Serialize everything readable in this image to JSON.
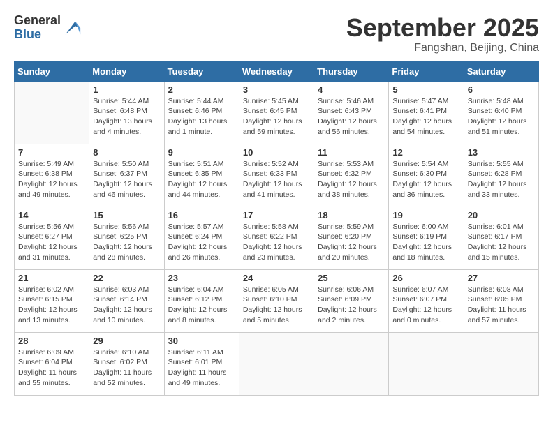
{
  "logo": {
    "general": "General",
    "blue": "Blue"
  },
  "header": {
    "month": "September 2025",
    "location": "Fangshan, Beijing, China"
  },
  "weekdays": [
    "Sunday",
    "Monday",
    "Tuesday",
    "Wednesday",
    "Thursday",
    "Friday",
    "Saturday"
  ],
  "weeks": [
    [
      {
        "day": "",
        "sunrise": "",
        "sunset": "",
        "daylight": ""
      },
      {
        "day": "1",
        "sunrise": "Sunrise: 5:44 AM",
        "sunset": "Sunset: 6:48 PM",
        "daylight": "Daylight: 13 hours and 4 minutes."
      },
      {
        "day": "2",
        "sunrise": "Sunrise: 5:44 AM",
        "sunset": "Sunset: 6:46 PM",
        "daylight": "Daylight: 13 hours and 1 minute."
      },
      {
        "day": "3",
        "sunrise": "Sunrise: 5:45 AM",
        "sunset": "Sunset: 6:45 PM",
        "daylight": "Daylight: 12 hours and 59 minutes."
      },
      {
        "day": "4",
        "sunrise": "Sunrise: 5:46 AM",
        "sunset": "Sunset: 6:43 PM",
        "daylight": "Daylight: 12 hours and 56 minutes."
      },
      {
        "day": "5",
        "sunrise": "Sunrise: 5:47 AM",
        "sunset": "Sunset: 6:41 PM",
        "daylight": "Daylight: 12 hours and 54 minutes."
      },
      {
        "day": "6",
        "sunrise": "Sunrise: 5:48 AM",
        "sunset": "Sunset: 6:40 PM",
        "daylight": "Daylight: 12 hours and 51 minutes."
      }
    ],
    [
      {
        "day": "7",
        "sunrise": "Sunrise: 5:49 AM",
        "sunset": "Sunset: 6:38 PM",
        "daylight": "Daylight: 12 hours and 49 minutes."
      },
      {
        "day": "8",
        "sunrise": "Sunrise: 5:50 AM",
        "sunset": "Sunset: 6:37 PM",
        "daylight": "Daylight: 12 hours and 46 minutes."
      },
      {
        "day": "9",
        "sunrise": "Sunrise: 5:51 AM",
        "sunset": "Sunset: 6:35 PM",
        "daylight": "Daylight: 12 hours and 44 minutes."
      },
      {
        "day": "10",
        "sunrise": "Sunrise: 5:52 AM",
        "sunset": "Sunset: 6:33 PM",
        "daylight": "Daylight: 12 hours and 41 minutes."
      },
      {
        "day": "11",
        "sunrise": "Sunrise: 5:53 AM",
        "sunset": "Sunset: 6:32 PM",
        "daylight": "Daylight: 12 hours and 38 minutes."
      },
      {
        "day": "12",
        "sunrise": "Sunrise: 5:54 AM",
        "sunset": "Sunset: 6:30 PM",
        "daylight": "Daylight: 12 hours and 36 minutes."
      },
      {
        "day": "13",
        "sunrise": "Sunrise: 5:55 AM",
        "sunset": "Sunset: 6:28 PM",
        "daylight": "Daylight: 12 hours and 33 minutes."
      }
    ],
    [
      {
        "day": "14",
        "sunrise": "Sunrise: 5:56 AM",
        "sunset": "Sunset: 6:27 PM",
        "daylight": "Daylight: 12 hours and 31 minutes."
      },
      {
        "day": "15",
        "sunrise": "Sunrise: 5:56 AM",
        "sunset": "Sunset: 6:25 PM",
        "daylight": "Daylight: 12 hours and 28 minutes."
      },
      {
        "day": "16",
        "sunrise": "Sunrise: 5:57 AM",
        "sunset": "Sunset: 6:24 PM",
        "daylight": "Daylight: 12 hours and 26 minutes."
      },
      {
        "day": "17",
        "sunrise": "Sunrise: 5:58 AM",
        "sunset": "Sunset: 6:22 PM",
        "daylight": "Daylight: 12 hours and 23 minutes."
      },
      {
        "day": "18",
        "sunrise": "Sunrise: 5:59 AM",
        "sunset": "Sunset: 6:20 PM",
        "daylight": "Daylight: 12 hours and 20 minutes."
      },
      {
        "day": "19",
        "sunrise": "Sunrise: 6:00 AM",
        "sunset": "Sunset: 6:19 PM",
        "daylight": "Daylight: 12 hours and 18 minutes."
      },
      {
        "day": "20",
        "sunrise": "Sunrise: 6:01 AM",
        "sunset": "Sunset: 6:17 PM",
        "daylight": "Daylight: 12 hours and 15 minutes."
      }
    ],
    [
      {
        "day": "21",
        "sunrise": "Sunrise: 6:02 AM",
        "sunset": "Sunset: 6:15 PM",
        "daylight": "Daylight: 12 hours and 13 minutes."
      },
      {
        "day": "22",
        "sunrise": "Sunrise: 6:03 AM",
        "sunset": "Sunset: 6:14 PM",
        "daylight": "Daylight: 12 hours and 10 minutes."
      },
      {
        "day": "23",
        "sunrise": "Sunrise: 6:04 AM",
        "sunset": "Sunset: 6:12 PM",
        "daylight": "Daylight: 12 hours and 8 minutes."
      },
      {
        "day": "24",
        "sunrise": "Sunrise: 6:05 AM",
        "sunset": "Sunset: 6:10 PM",
        "daylight": "Daylight: 12 hours and 5 minutes."
      },
      {
        "day": "25",
        "sunrise": "Sunrise: 6:06 AM",
        "sunset": "Sunset: 6:09 PM",
        "daylight": "Daylight: 12 hours and 2 minutes."
      },
      {
        "day": "26",
        "sunrise": "Sunrise: 6:07 AM",
        "sunset": "Sunset: 6:07 PM",
        "daylight": "Daylight: 12 hours and 0 minutes."
      },
      {
        "day": "27",
        "sunrise": "Sunrise: 6:08 AM",
        "sunset": "Sunset: 6:05 PM",
        "daylight": "Daylight: 11 hours and 57 minutes."
      }
    ],
    [
      {
        "day": "28",
        "sunrise": "Sunrise: 6:09 AM",
        "sunset": "Sunset: 6:04 PM",
        "daylight": "Daylight: 11 hours and 55 minutes."
      },
      {
        "day": "29",
        "sunrise": "Sunrise: 6:10 AM",
        "sunset": "Sunset: 6:02 PM",
        "daylight": "Daylight: 11 hours and 52 minutes."
      },
      {
        "day": "30",
        "sunrise": "Sunrise: 6:11 AM",
        "sunset": "Sunset: 6:01 PM",
        "daylight": "Daylight: 11 hours and 49 minutes."
      },
      {
        "day": "",
        "sunrise": "",
        "sunset": "",
        "daylight": ""
      },
      {
        "day": "",
        "sunrise": "",
        "sunset": "",
        "daylight": ""
      },
      {
        "day": "",
        "sunrise": "",
        "sunset": "",
        "daylight": ""
      },
      {
        "day": "",
        "sunrise": "",
        "sunset": "",
        "daylight": ""
      }
    ]
  ]
}
